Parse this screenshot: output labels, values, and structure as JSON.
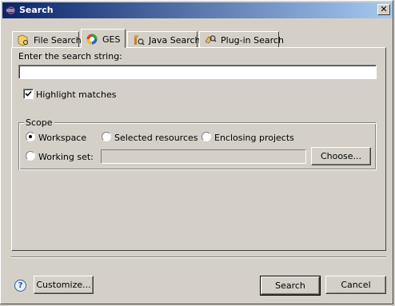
{
  "window": {
    "title": "Search"
  },
  "tabs": [
    {
      "label": "File Search",
      "icon": "file-search-icon",
      "active": false
    },
    {
      "label": "GES",
      "icon": "ges-icon",
      "active": true
    },
    {
      "label": "Java Search",
      "icon": "java-search-icon",
      "active": false
    },
    {
      "label": "Plug-in Search",
      "icon": "plugin-search-icon",
      "active": false
    }
  ],
  "search": {
    "prompt_label": "Enter the search string:",
    "value": "",
    "highlight_label": "Highlight matches",
    "highlight_checked": true
  },
  "scope": {
    "title": "Scope",
    "options": [
      "Workspace",
      "Selected resources",
      "Enclosing projects",
      "Working set:"
    ],
    "selected": "Workspace",
    "working_set_value": "",
    "choose_label": "Choose..."
  },
  "footer": {
    "customize_label": "Customize...",
    "search_label": "Search",
    "cancel_label": "Cancel"
  },
  "colors": {
    "title_start": "#0a246a",
    "title_end": "#a6caf0",
    "face": "#d4d0c8"
  }
}
